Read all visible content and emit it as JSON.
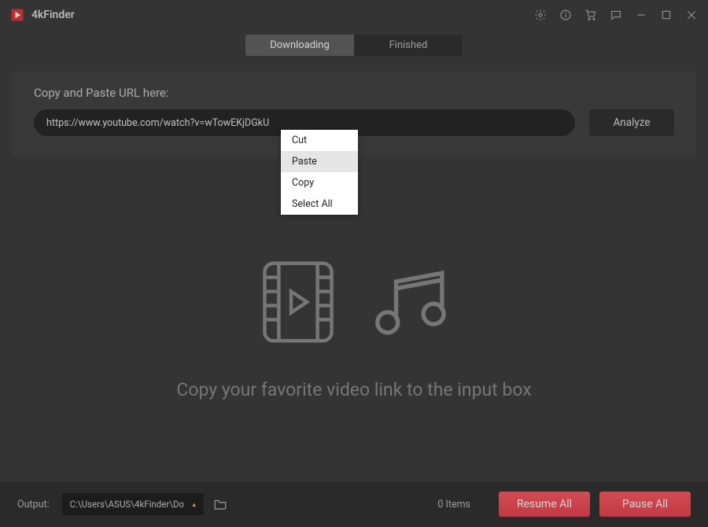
{
  "app": {
    "title": "4kFinder"
  },
  "tabs": {
    "downloading": "Downloading",
    "finished": "Finished"
  },
  "url_section": {
    "label": "Copy and Paste URL here:",
    "value": "https://www.youtube.com/watch?v=wTowEKjDGkU",
    "analyze_label": "Analyze"
  },
  "context_menu": {
    "cut": "Cut",
    "paste": "Paste",
    "copy": "Copy",
    "select_all": "Select All"
  },
  "placeholder_text": "Copy your favorite video link to the input box",
  "footer": {
    "output_label": "Output:",
    "output_path": "C:\\Users\\ASUS\\4kFinder\\Do",
    "items_count": "0 Items",
    "resume_label": "Resume All",
    "pause_label": "Pause All"
  }
}
